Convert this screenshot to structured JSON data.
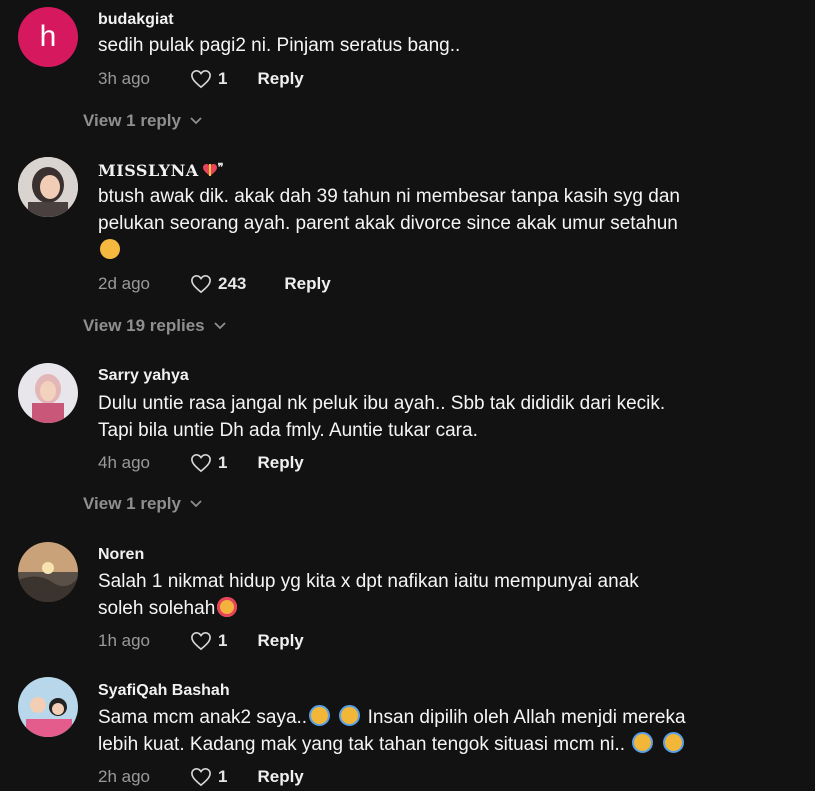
{
  "comments": [
    {
      "avatar_letter": "h",
      "username": "budakgiat",
      "text": "sedih pulak pagi2 ni. Pinjam seratus bang..",
      "time": "3h ago",
      "likes": "1",
      "reply": "Reply",
      "view_replies": "View 1 reply"
    },
    {
      "username": "MISSLYNA",
      "text_lines": [
        "btush awak dik. akak dah 39 tahun ni membesar tanpa kasih syg dan",
        "pelukan seorang ayah. parent akak divorce since akak umur setahun"
      ],
      "time": "2d ago",
      "likes": "243",
      "reply": "Reply",
      "view_replies": "View 19 replies"
    },
    {
      "username": "Sarry yahya",
      "text_lines": [
        "Dulu untie rasa jangal nk peluk ibu ayah.. Sbb tak dididik dari kecik.",
        "Tapi bila untie Dh ada fmly. Auntie tukar cara."
      ],
      "time": "4h ago",
      "likes": "1",
      "reply": "Reply",
      "view_replies": "View 1 reply"
    },
    {
      "username": "Noren",
      "text_lines": [
        "Salah 1 nikmat hidup yg kita x dpt nafikan iaitu mempunyai anak",
        "soleh solehah"
      ],
      "time": "1h ago",
      "likes": "1",
      "reply": "Reply"
    },
    {
      "username": "SyafiQah Bashah",
      "text_line1_a": "Sama mcm anak2 saya..",
      "text_line1_b": "Insan dipilih oleh Allah menjdi mereka",
      "text_line2": "lebih kuat. Kadang mak yang tak tahan tengok situasi mcm ni..",
      "time": "2h ago",
      "likes": "1",
      "reply": "Reply"
    }
  ],
  "colors": {
    "background": "#121212",
    "avatar_letter_bg": "#d6195e",
    "muted_text": "#9a9a9a"
  },
  "icons": {
    "like": "heart-outline-icon",
    "expand": "chevron-down-icon"
  }
}
